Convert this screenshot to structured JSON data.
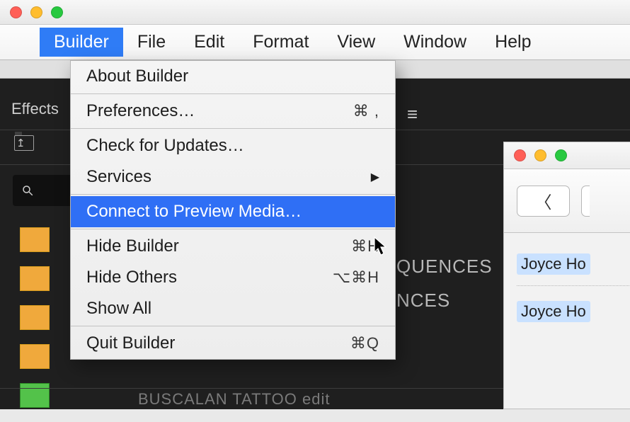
{
  "menubar": {
    "app_name": "Builder",
    "items": [
      "File",
      "Edit",
      "Format",
      "View",
      "Window",
      "Help"
    ]
  },
  "app_menu": {
    "about": "About Builder",
    "preferences": "Preferences…",
    "preferences_sc": "⌘ ,",
    "check_updates": "Check for Updates…",
    "services": "Services",
    "connect": "Connect to Preview Media…",
    "hide": "Hide Builder",
    "hide_sc": "⌘H",
    "hide_others": "Hide Others",
    "hide_others_sc": "⌥⌘H",
    "show_all": "Show All",
    "quit": "Quit Builder",
    "quit_sc": "⌘Q"
  },
  "panel": {
    "effects": "Effects",
    "partial_a": "QUENCES",
    "partial_b": "NCES",
    "bottom_partial": "BUSCALAN TATTOO  edit"
  },
  "finder": {
    "item_a": "Joyce Ho",
    "item_b": "Joyce Ho"
  }
}
